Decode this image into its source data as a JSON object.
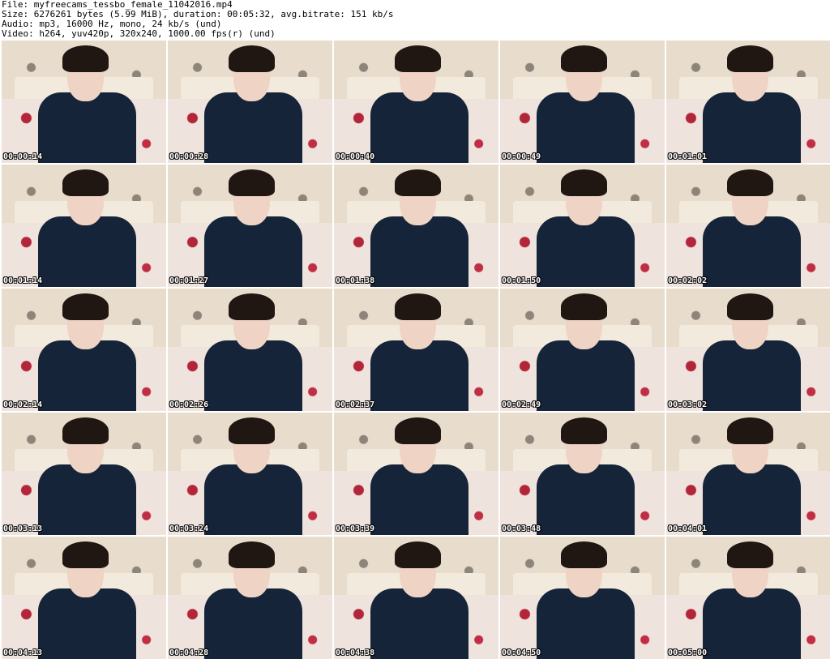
{
  "header": {
    "file_line": "File: myfreecams_tessbo_female_11042016.mp4",
    "size_line": "Size: 6276261 bytes (5.99 MiB), duration: 00:05:32, avg.bitrate: 151 kb/s",
    "audio_line": "Audio: mp3, 16000 Hz, mono, 24 kb/s (und)",
    "video_line": "Video: h264, yuv420p, 320x240, 1000.00 fps(r) (und)"
  },
  "thumbnails": [
    {
      "timestamp": "00:00:14"
    },
    {
      "timestamp": "00:00:28"
    },
    {
      "timestamp": "00:00:40"
    },
    {
      "timestamp": "00:00:49"
    },
    {
      "timestamp": "00:01:01"
    },
    {
      "timestamp": "00:01:14"
    },
    {
      "timestamp": "00:01:27"
    },
    {
      "timestamp": "00:01:38"
    },
    {
      "timestamp": "00:01:50"
    },
    {
      "timestamp": "00:02:02"
    },
    {
      "timestamp": "00:02:14"
    },
    {
      "timestamp": "00:02:26"
    },
    {
      "timestamp": "00:02:37"
    },
    {
      "timestamp": "00:02:49"
    },
    {
      "timestamp": "00:03:02"
    },
    {
      "timestamp": "00:03:13"
    },
    {
      "timestamp": "00:03:24"
    },
    {
      "timestamp": "00:03:39"
    },
    {
      "timestamp": "00:03:48"
    },
    {
      "timestamp": "00:04:01"
    },
    {
      "timestamp": "00:04:13"
    },
    {
      "timestamp": "00:04:28"
    },
    {
      "timestamp": "00:04:38"
    },
    {
      "timestamp": "00:04:50"
    },
    {
      "timestamp": "00:05:00"
    }
  ]
}
